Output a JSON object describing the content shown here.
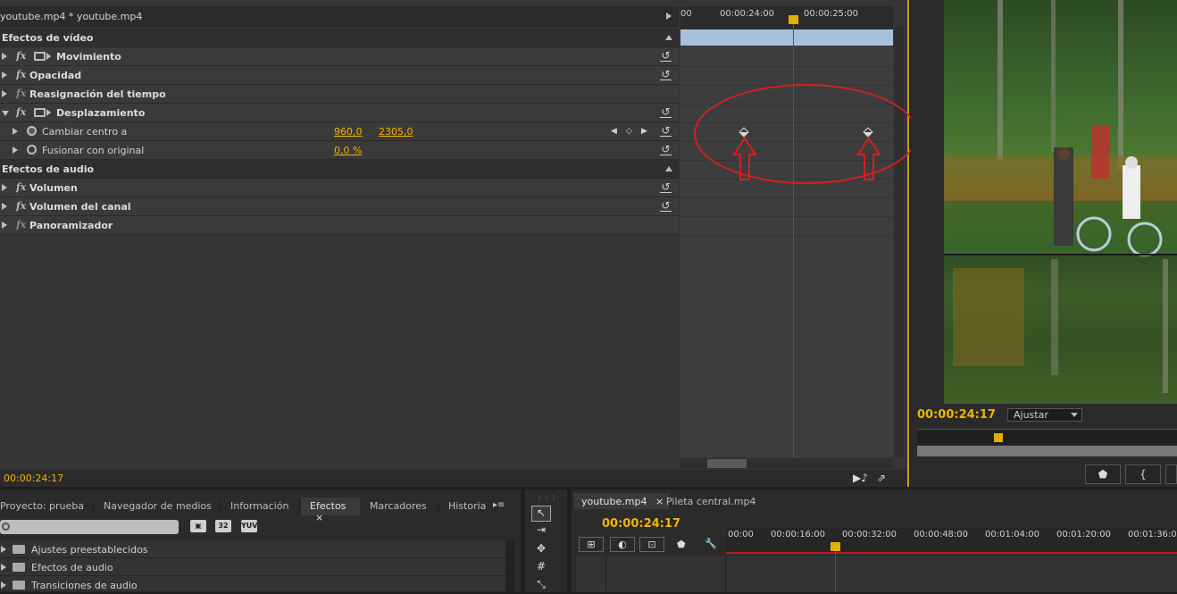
{
  "effect_controls": {
    "header_title": "youtube.mp4 * youtube.mp4",
    "current_time": "00:00:24:17",
    "sections": {
      "video": "Efectos de vídeo",
      "audio": "Efectos de audio"
    },
    "video_effects": [
      {
        "label": "Movimiento"
      },
      {
        "label": "Opacidad"
      },
      {
        "label": "Reasignación del tiempo"
      },
      {
        "label": "Desplazamiento"
      }
    ],
    "params": [
      {
        "label": "Cambiar centro a",
        "value1": "960,0",
        "value2": "2305,0"
      },
      {
        "label": "Fusionar con original",
        "value1": "0,0 %"
      }
    ],
    "audio_effects": [
      {
        "label": "Volumen"
      },
      {
        "label": "Volumen del canal"
      },
      {
        "label": "Panoramizador"
      }
    ],
    "fx_label": "fx",
    "timeline": {
      "ticks": [
        "00",
        "00:00:24:00",
        "00:00:25:00"
      ]
    }
  },
  "program_monitor": {
    "current_time": "00:00:24:17",
    "fit_select": "Ajustar"
  },
  "project_panel": {
    "tabs": [
      "Proyecto: prueba",
      "Navegador de medios",
      "Información",
      "Efectos",
      "Marcadores",
      "Historia"
    ],
    "active_tab": "Efectos",
    "icon_labels": [
      "32",
      "YUV"
    ],
    "tree": [
      "Ajustes preestablecidos",
      "Efectos de audio",
      "Transiciones de audio"
    ]
  },
  "timeline": {
    "tabs": [
      "youtube.mp4",
      "Pileta central.mp4"
    ],
    "current_time": "00:00:24:17",
    "ticks": [
      "00:00",
      "00:00:16:00",
      "00:00:32:00",
      "00:00:48:00",
      "00:01:04:00",
      "00:01:20:00",
      "00:01:36:0"
    ]
  },
  "colors": {
    "accent": "#f0b400",
    "playhead": "#d02020",
    "annotation": "#d42020",
    "work_area": "#a9c0dc"
  }
}
